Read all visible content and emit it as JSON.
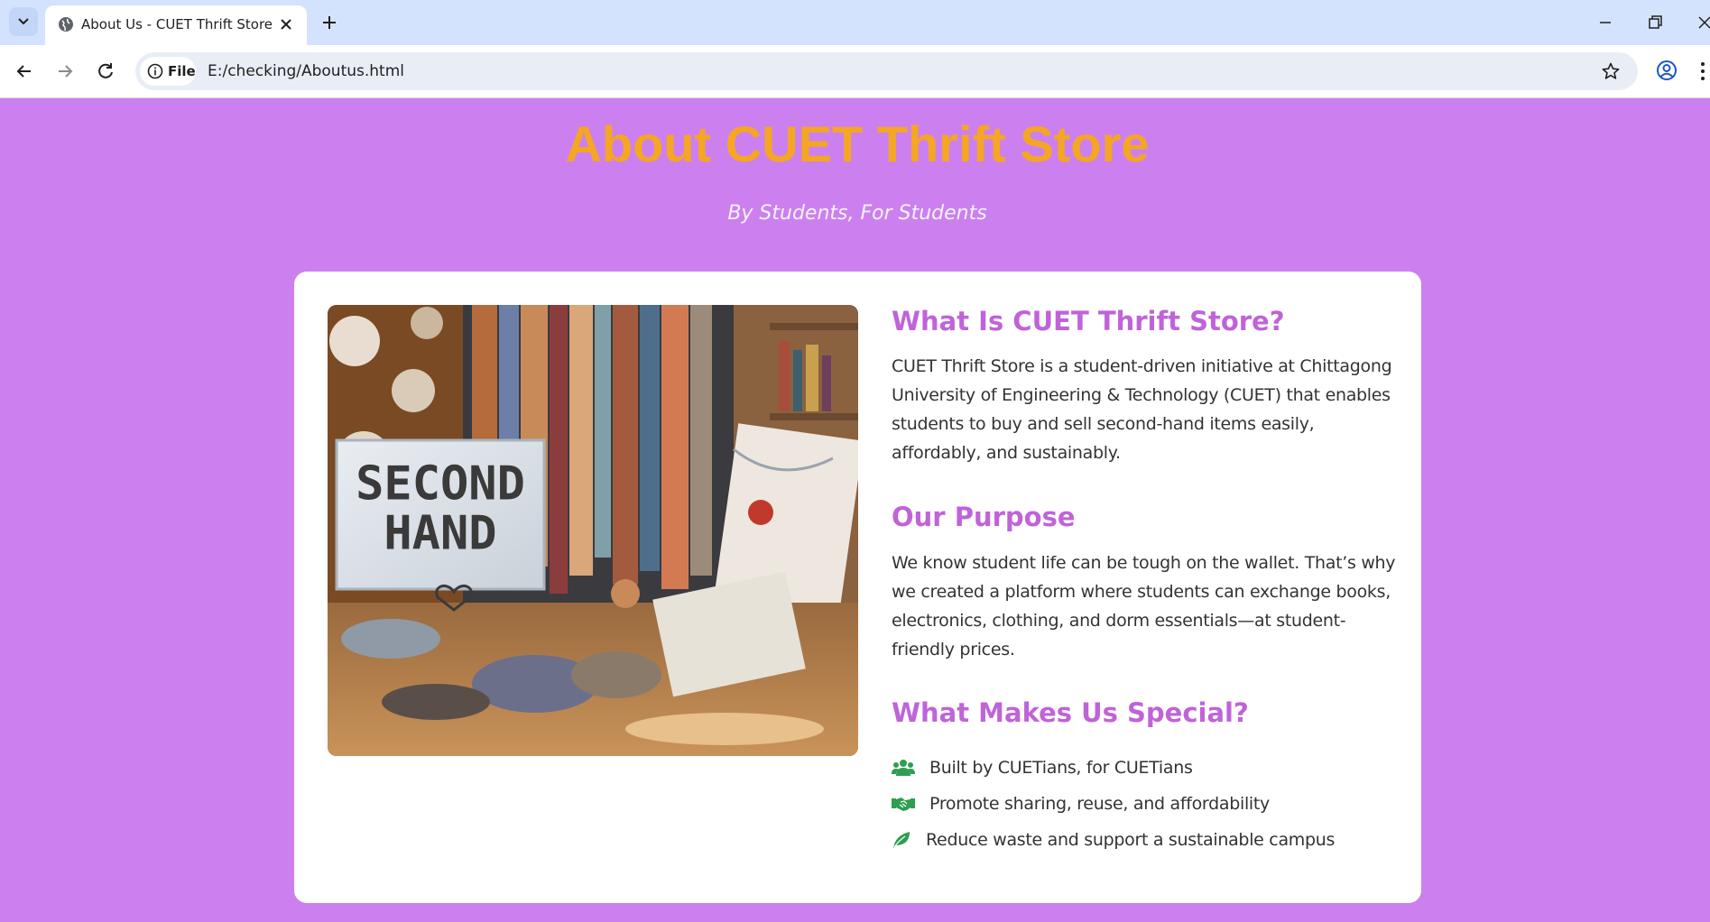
{
  "browser": {
    "tab_title": "About Us - CUET Thrift Store",
    "chip_label": "File",
    "url": "E:/checking/Aboutus.html"
  },
  "page": {
    "title": "About CUET Thrift Store",
    "subtitle": "By Students, For Students"
  },
  "sections": [
    {
      "heading": "What Is CUET Thrift Store?",
      "body": "CUET Thrift Store is a student-driven initiative at Chittagong University of Engineering & Technology (CUET) that enables students to buy and sell second-hand items easily, affordably, and sustainably."
    },
    {
      "heading": "Our Purpose",
      "body": "We know student life can be tough on the wallet. That’s why we created a platform where students can exchange books, electronics, clothing, and dorm essentials—at student-friendly prices."
    },
    {
      "heading": "What Makes Us Special?"
    }
  ],
  "features": [
    {
      "icon": "users-icon",
      "text": "Built by CUETians, for CUETians"
    },
    {
      "icon": "handshake-icon",
      "text": "Promote sharing, reuse, and affordability"
    },
    {
      "icon": "leaf-icon",
      "text": "Reduce waste and support a sustainable campus"
    }
  ],
  "photo": {
    "sign_line1": "SECOND",
    "sign_line2": "HAND"
  },
  "colors": {
    "page_bg": "#cc80ef",
    "title": "#f5a623",
    "heading": "#c063d9",
    "icon_green": "#2e9e4f"
  }
}
